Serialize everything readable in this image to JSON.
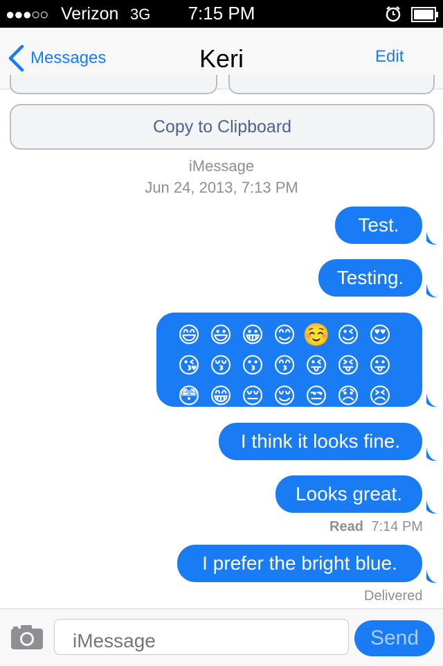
{
  "status_bar": {
    "signal": "●●●○○",
    "carrier": "Verizon",
    "network": "3G",
    "time": "7:15 PM",
    "icons": [
      "alarm-icon",
      "battery-icon"
    ]
  },
  "nav": {
    "back_label": "Messages",
    "title": "Keri",
    "edit_label": "Edit"
  },
  "actions": {
    "copy_label": "Copy to Clipboard"
  },
  "conversation": {
    "service": "iMessage",
    "date": "Jun 24, 2013, 7:13 PM",
    "messages": [
      {
        "text": "Test."
      },
      {
        "text": "Testing."
      },
      {
        "emoji": [
          "😄",
          "😃",
          "😀",
          "😊",
          "☺️",
          "😉",
          "😍",
          "😘",
          "😚",
          "😗",
          "😙",
          "😜",
          "😝",
          "😛",
          "😳",
          "😁",
          "😔",
          "😌",
          "😒",
          "😞",
          "😣"
        ]
      },
      {
        "text": "I think it looks fine."
      },
      {
        "text": "Looks great."
      },
      {
        "text": "I prefer the bright blue."
      }
    ],
    "read_label": "Read",
    "read_time": "7:14 PM",
    "delivered_label": "Delivered"
  },
  "composer": {
    "placeholder": "iMessage",
    "send_label": "Send"
  },
  "colors": {
    "bubble": "#1a7cf5",
    "accent": "#1a7cf5"
  }
}
